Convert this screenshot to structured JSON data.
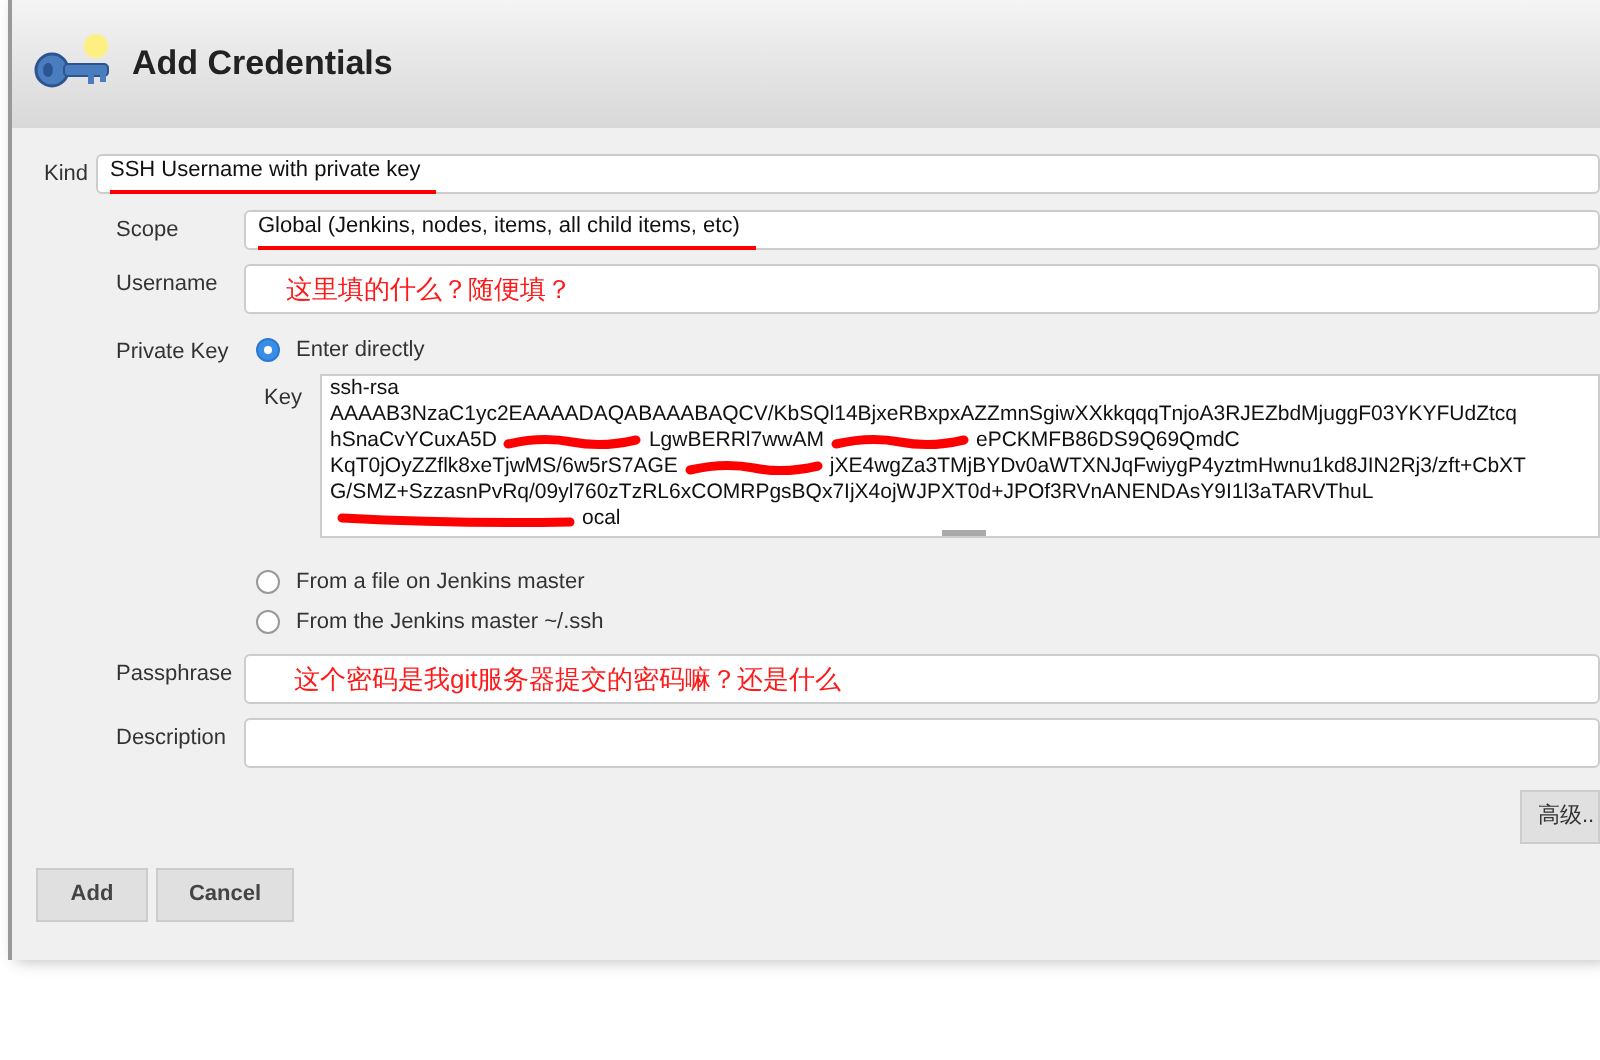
{
  "header": {
    "title": "Add Credentials"
  },
  "form": {
    "kind": {
      "label": "Kind",
      "value": "SSH Username with private key",
      "underlined": true
    },
    "scope": {
      "label": "Scope",
      "value": "Global (Jenkins, nodes, items, all child items, etc)",
      "underlined": true
    },
    "username": {
      "label": "Username",
      "annotation": "这里填的什么？随便填？"
    },
    "private_key": {
      "label": "Private Key",
      "options": [
        {
          "label": "Enter directly",
          "selected": true
        },
        {
          "label": "From a file on Jenkins master",
          "selected": false
        },
        {
          "label": "From the Jenkins master ~/.ssh",
          "selected": false
        }
      ],
      "key_label": "Key",
      "key_lines": [
        [
          "ssh-rsa"
        ],
        [
          "AAAAB3NzaC1yc2EAAAADAQABAAABAQCV/KbSQl14BjxeRBxpxAZZmnSgiwXXkkqqqTnjoA3RJEZbdMjuggF03YKYFUdZtcq"
        ],
        [
          "hSnaCvYCuxA5D",
          "LgwBERRl7wwAM",
          "ePCKMFB86DS9Q69QmdC"
        ],
        [
          "KqT0jOyZZflk8xeTjwMS/6w5rS7AGE",
          "jXE4wgZa3TMjBYDv0aWTXNJqFwiygP4yztmHwnu1kd8JIN2Rj3/zft+CbXT"
        ],
        [
          "G/SMZ+SzzasnPvRq/09yl760zTzRL6xCOMRPgsBQx7IjX4ojWJPXT0d+JPOf3RVnANENDAsY9I1l3aTARVThuL"
        ],
        [
          "ocal"
        ]
      ]
    },
    "passphrase": {
      "label": "Passphrase",
      "annotation": "这个密码是我git服务器提交的密码嘛？还是什么"
    },
    "description": {
      "label": "Description"
    },
    "advanced_button": "高级..",
    "buttons": [
      "Add",
      "Cancel"
    ]
  }
}
